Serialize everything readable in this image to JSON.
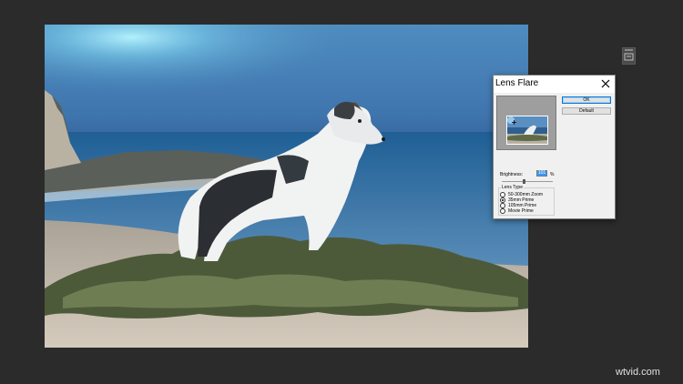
{
  "dialog": {
    "title": "Lens Flare",
    "ok_label": "OK",
    "default_label": "Default",
    "brightness_label": "Brightness:",
    "brightness_value": "101",
    "brightness_unit": "%",
    "brightness_slider_level": 0.45,
    "lens_type_label": "Lens Type",
    "lens_types": [
      {
        "label": "50-300mm Zoom",
        "selected": false
      },
      {
        "label": "35mm Prime",
        "selected": true
      },
      {
        "label": "105mm Prime",
        "selected": false
      },
      {
        "label": "Movie Prime",
        "selected": false
      }
    ]
  },
  "watermark": "wtvid.com",
  "icons": {
    "close": "close-icon",
    "panel": "panel-icon"
  }
}
